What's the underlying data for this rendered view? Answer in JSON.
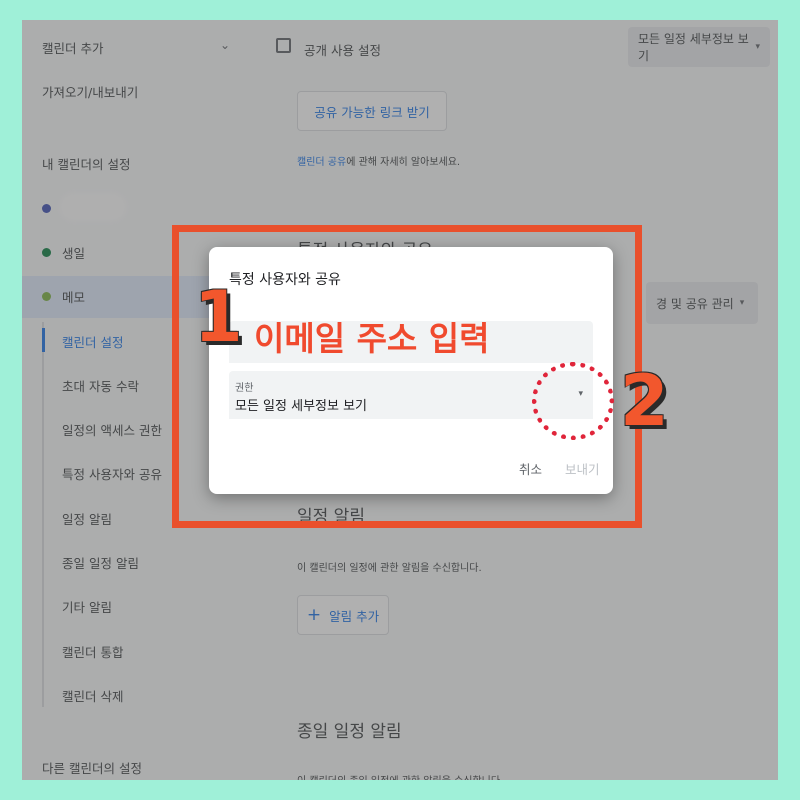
{
  "sidebar": {
    "add_calendar": "캘린더 추가",
    "import_export": "가져오기/내보내기",
    "my_settings_title": "내 캘린더의 설정",
    "calendars": [
      {
        "label": "",
        "color": "#3f51b5"
      },
      {
        "label": "생일",
        "color": "#0b8043"
      },
      {
        "label": "메모",
        "color": "#7cb342"
      }
    ],
    "sub_items": [
      "캘린더 설정",
      "초대 자동 수락",
      "일정의 액세스 권한",
      "특정 사용자와 공유",
      "일정 알림",
      "종일 일정 알림",
      "기타 알림",
      "캘린더 통합",
      "캘린더 삭제"
    ],
    "other_settings": "다른 캘린더의 설정"
  },
  "main": {
    "public_checkbox_label": "공개 사용 설정",
    "public_select": "모든 일정 세부정보 보기",
    "share_link_button": "공유 가능한 링크 받기",
    "learn_more_link": "캘린더 공유",
    "learn_more_suffix": "에 관해 자세히 알아보세요.",
    "share_section_title": "특정 사용자와 공유",
    "share_manage_button": "경 및 공유 관리",
    "event_alerts_title": "일정 알림",
    "event_alerts_desc": "이 캘린더의 일정에 관한 알림을 수신합니다.",
    "add_alert_button": "알림 추가",
    "allday_alerts_title": "종일 일정 알림",
    "allday_alerts_desc": "이 캘린더의 종일 일정에 관한 알림을 수신합니다."
  },
  "dialog": {
    "title": "특정 사용자와 공유",
    "email_placeholder": "",
    "permission_label": "권한",
    "permission_value": "모든 일정 세부정보 보기",
    "cancel": "취소",
    "send": "보내기"
  },
  "annotations": {
    "step1_number": "1",
    "step1_text": "이메일 주소 입력",
    "step2_number": "2",
    "accent_color": "#f2572d"
  }
}
